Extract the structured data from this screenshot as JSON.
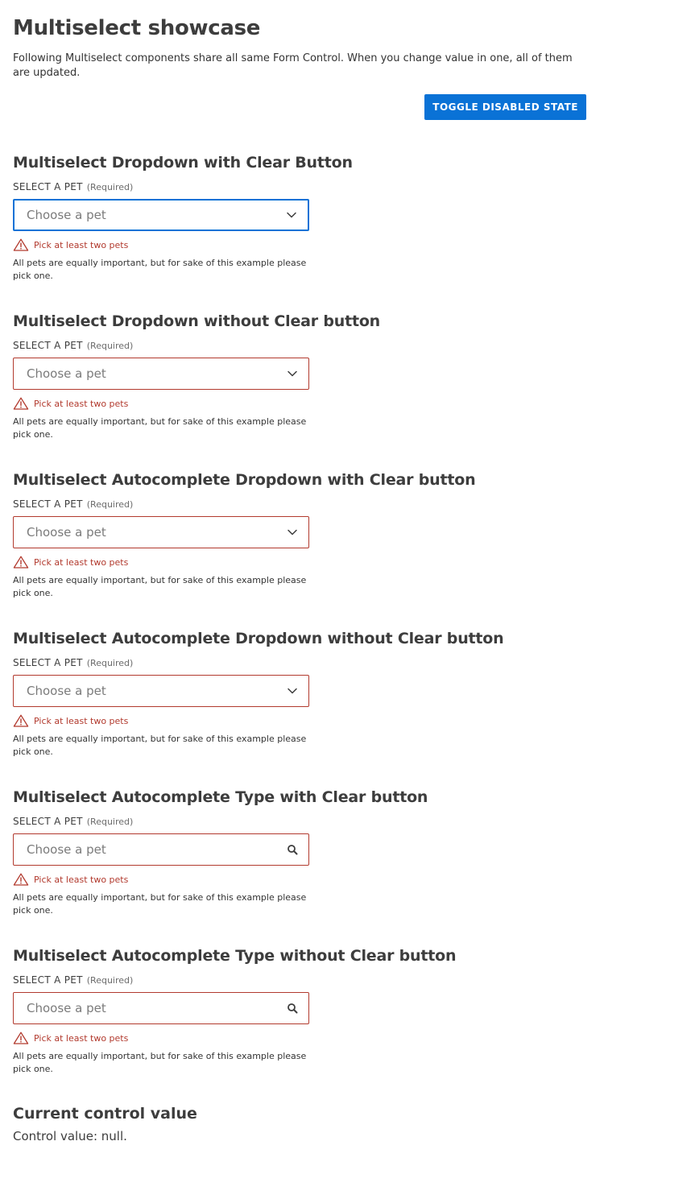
{
  "page": {
    "title": "Multiselect showcase",
    "intro": "Following Multiselect components share all same Form Control. When you change value in one, all of them are updated.",
    "toggle_label": "TOGGLE DISABLED STATE"
  },
  "colors": {
    "accent": "#0a72d6",
    "error": "#b23a2e"
  },
  "sections": [
    {
      "title": "Multiselect Dropdown with Clear Button",
      "label": "SELECT A PET",
      "required": "(Required)",
      "placeholder": "Choose a pet",
      "icon": "chevron-down-icon",
      "error": "Pick at least two pets",
      "hint": "All pets are equally important, but for sake of this example please pick one."
    },
    {
      "title": "Multiselect Dropdown without Clear button",
      "label": "SELECT A PET",
      "required": "(Required)",
      "placeholder": "Choose a pet",
      "icon": "chevron-down-icon",
      "error": "Pick at least two pets",
      "hint": "All pets are equally important, but for sake of this example please pick one."
    },
    {
      "title": "Multiselect Autocomplete Dropdown with Clear button",
      "label": "SELECT A PET",
      "required": "(Required)",
      "placeholder": "Choose a pet",
      "icon": "chevron-down-icon",
      "error": "Pick at least two pets",
      "hint": "All pets are equally important, but for sake of this example please pick one."
    },
    {
      "title": "Multiselect Autocomplete Dropdown without Clear button",
      "label": "SELECT A PET",
      "required": "(Required)",
      "placeholder": "Choose a pet",
      "icon": "chevron-down-icon",
      "error": "Pick at least two pets",
      "hint": "All pets are equally important, but for sake of this example please pick one."
    },
    {
      "title": "Multiselect Autocomplete Type with Clear button",
      "label": "SELECT A PET",
      "required": "(Required)",
      "placeholder": "Choose a pet",
      "icon": "search-icon",
      "error": "Pick at least two pets",
      "hint": "All pets are equally important, but for sake of this example please pick one."
    },
    {
      "title": "Multiselect Autocomplete Type without Clear button",
      "label": "SELECT A PET",
      "required": "(Required)",
      "placeholder": "Choose a pet",
      "icon": "search-icon",
      "error": "Pick at least two pets",
      "hint": "All pets are equally important, but for sake of this example please pick one."
    }
  ],
  "current_value": {
    "title": "Current control value",
    "text": "Control value: null."
  }
}
